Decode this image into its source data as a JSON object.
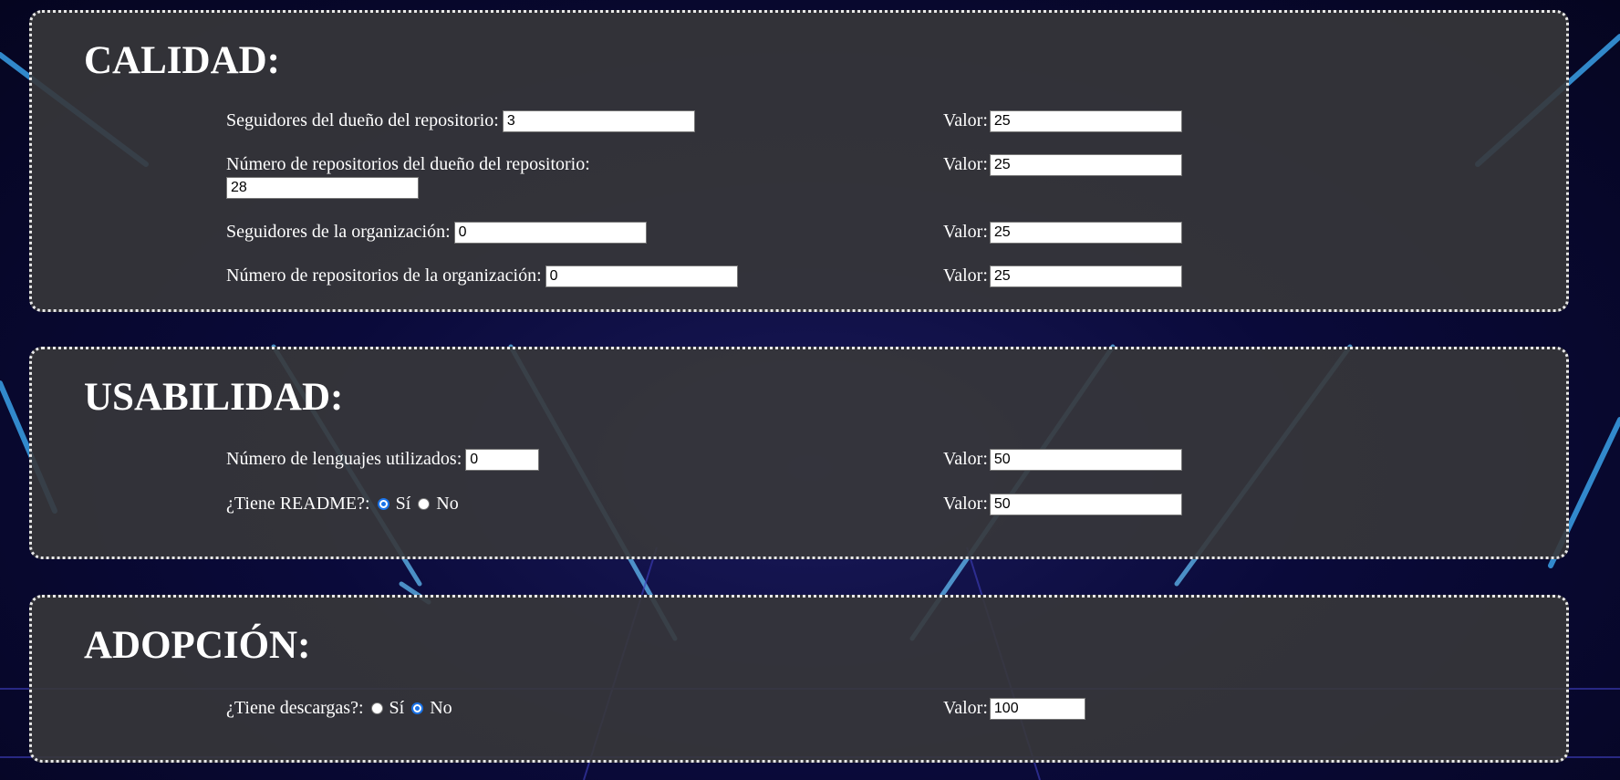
{
  "calidad": {
    "title": "CALIDAD:",
    "rows": [
      {
        "label": "Seguidores del dueño del repositorio:",
        "value": "3",
        "valor_label": "Valor:",
        "valor": "25"
      },
      {
        "label": "Número de repositorios del dueño del repositorio:",
        "value": "28",
        "valor_label": "Valor:",
        "valor": "25"
      },
      {
        "label": "Seguidores de la organización:",
        "value": "0",
        "valor_label": "Valor:",
        "valor": "25"
      },
      {
        "label": "Número de repositorios de la organización:",
        "value": "0",
        "valor_label": "Valor:",
        "valor": "25"
      }
    ]
  },
  "usabilidad": {
    "title": "USABILIDAD:",
    "lenguajes": {
      "label": "Número de lenguajes utilizados:",
      "value": "0",
      "valor_label": "Valor:",
      "valor": "50"
    },
    "readme": {
      "label": "¿Tiene README?:",
      "si": "Sí",
      "no": "No",
      "selected": "Sí",
      "valor_label": "Valor:",
      "valor": "50"
    }
  },
  "adopcion": {
    "title": "ADOPCIÓN:",
    "descargas": {
      "label": "¿Tiene descargas?:",
      "si": "Sí",
      "no": "No",
      "selected": "No",
      "valor_label": "Valor:",
      "valor": "100"
    }
  },
  "colors": {
    "panel": "#37373a",
    "border": "#e8e8e8",
    "accent_radio": "#1a73e8",
    "background": "#0a0a3a"
  }
}
